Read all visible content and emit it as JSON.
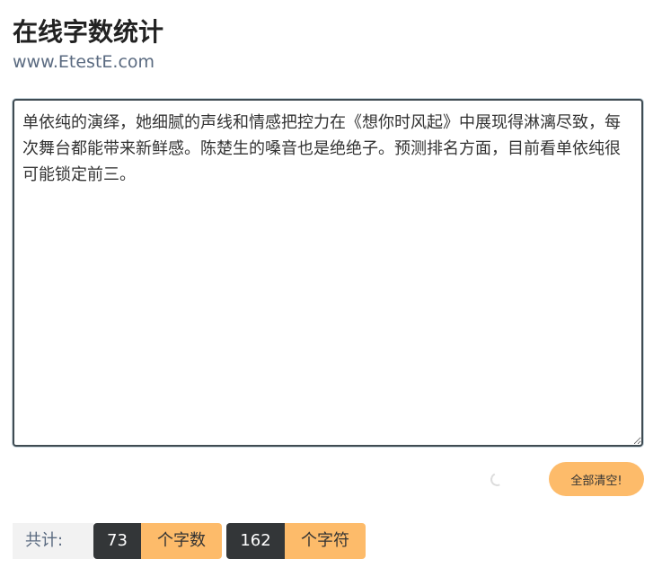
{
  "header": {
    "title": "在线字数统计",
    "site": "www.EtestE.com"
  },
  "editor": {
    "value": "单依纯的演绎，她细腻的声线和情感把控力在《想你时风起》中展现得淋漓尽致，每次舞台都能带来新鲜感。陈楚生的嗓音也是绝绝子。预测排名方面，目前看单依纯很可能锁定前三。"
  },
  "actions": {
    "clear_label": "全部清空!",
    "loading_icon": "spinner-icon"
  },
  "stats": {
    "total_label": "共计:",
    "word_count": "73",
    "word_unit": "个字数",
    "char_count": "162",
    "char_unit": "个字符"
  },
  "colors": {
    "accent": "#fdbb6a",
    "dark": "#333638",
    "label_bg": "#f2f2f2"
  }
}
